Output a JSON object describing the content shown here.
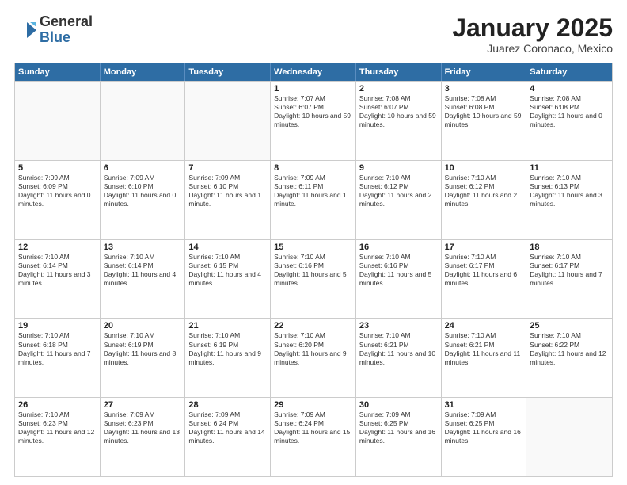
{
  "logo": {
    "general": "General",
    "blue": "Blue"
  },
  "header": {
    "month": "January 2025",
    "location": "Juarez Coronaco, Mexico"
  },
  "weekdays": [
    "Sunday",
    "Monday",
    "Tuesday",
    "Wednesday",
    "Thursday",
    "Friday",
    "Saturday"
  ],
  "weeks": [
    [
      {
        "day": "",
        "info": ""
      },
      {
        "day": "",
        "info": ""
      },
      {
        "day": "",
        "info": ""
      },
      {
        "day": "1",
        "info": "Sunrise: 7:07 AM\nSunset: 6:07 PM\nDaylight: 10 hours and 59 minutes."
      },
      {
        "day": "2",
        "info": "Sunrise: 7:08 AM\nSunset: 6:07 PM\nDaylight: 10 hours and 59 minutes."
      },
      {
        "day": "3",
        "info": "Sunrise: 7:08 AM\nSunset: 6:08 PM\nDaylight: 10 hours and 59 minutes."
      },
      {
        "day": "4",
        "info": "Sunrise: 7:08 AM\nSunset: 6:08 PM\nDaylight: 11 hours and 0 minutes."
      }
    ],
    [
      {
        "day": "5",
        "info": "Sunrise: 7:09 AM\nSunset: 6:09 PM\nDaylight: 11 hours and 0 minutes."
      },
      {
        "day": "6",
        "info": "Sunrise: 7:09 AM\nSunset: 6:10 PM\nDaylight: 11 hours and 0 minutes."
      },
      {
        "day": "7",
        "info": "Sunrise: 7:09 AM\nSunset: 6:10 PM\nDaylight: 11 hours and 1 minute."
      },
      {
        "day": "8",
        "info": "Sunrise: 7:09 AM\nSunset: 6:11 PM\nDaylight: 11 hours and 1 minute."
      },
      {
        "day": "9",
        "info": "Sunrise: 7:10 AM\nSunset: 6:12 PM\nDaylight: 11 hours and 2 minutes."
      },
      {
        "day": "10",
        "info": "Sunrise: 7:10 AM\nSunset: 6:12 PM\nDaylight: 11 hours and 2 minutes."
      },
      {
        "day": "11",
        "info": "Sunrise: 7:10 AM\nSunset: 6:13 PM\nDaylight: 11 hours and 3 minutes."
      }
    ],
    [
      {
        "day": "12",
        "info": "Sunrise: 7:10 AM\nSunset: 6:14 PM\nDaylight: 11 hours and 3 minutes."
      },
      {
        "day": "13",
        "info": "Sunrise: 7:10 AM\nSunset: 6:14 PM\nDaylight: 11 hours and 4 minutes."
      },
      {
        "day": "14",
        "info": "Sunrise: 7:10 AM\nSunset: 6:15 PM\nDaylight: 11 hours and 4 minutes."
      },
      {
        "day": "15",
        "info": "Sunrise: 7:10 AM\nSunset: 6:16 PM\nDaylight: 11 hours and 5 minutes."
      },
      {
        "day": "16",
        "info": "Sunrise: 7:10 AM\nSunset: 6:16 PM\nDaylight: 11 hours and 5 minutes."
      },
      {
        "day": "17",
        "info": "Sunrise: 7:10 AM\nSunset: 6:17 PM\nDaylight: 11 hours and 6 minutes."
      },
      {
        "day": "18",
        "info": "Sunrise: 7:10 AM\nSunset: 6:17 PM\nDaylight: 11 hours and 7 minutes."
      }
    ],
    [
      {
        "day": "19",
        "info": "Sunrise: 7:10 AM\nSunset: 6:18 PM\nDaylight: 11 hours and 7 minutes."
      },
      {
        "day": "20",
        "info": "Sunrise: 7:10 AM\nSunset: 6:19 PM\nDaylight: 11 hours and 8 minutes."
      },
      {
        "day": "21",
        "info": "Sunrise: 7:10 AM\nSunset: 6:19 PM\nDaylight: 11 hours and 9 minutes."
      },
      {
        "day": "22",
        "info": "Sunrise: 7:10 AM\nSunset: 6:20 PM\nDaylight: 11 hours and 9 minutes."
      },
      {
        "day": "23",
        "info": "Sunrise: 7:10 AM\nSunset: 6:21 PM\nDaylight: 11 hours and 10 minutes."
      },
      {
        "day": "24",
        "info": "Sunrise: 7:10 AM\nSunset: 6:21 PM\nDaylight: 11 hours and 11 minutes."
      },
      {
        "day": "25",
        "info": "Sunrise: 7:10 AM\nSunset: 6:22 PM\nDaylight: 11 hours and 12 minutes."
      }
    ],
    [
      {
        "day": "26",
        "info": "Sunrise: 7:10 AM\nSunset: 6:23 PM\nDaylight: 11 hours and 12 minutes."
      },
      {
        "day": "27",
        "info": "Sunrise: 7:09 AM\nSunset: 6:23 PM\nDaylight: 11 hours and 13 minutes."
      },
      {
        "day": "28",
        "info": "Sunrise: 7:09 AM\nSunset: 6:24 PM\nDaylight: 11 hours and 14 minutes."
      },
      {
        "day": "29",
        "info": "Sunrise: 7:09 AM\nSunset: 6:24 PM\nDaylight: 11 hours and 15 minutes."
      },
      {
        "day": "30",
        "info": "Sunrise: 7:09 AM\nSunset: 6:25 PM\nDaylight: 11 hours and 16 minutes."
      },
      {
        "day": "31",
        "info": "Sunrise: 7:09 AM\nSunset: 6:25 PM\nDaylight: 11 hours and 16 minutes."
      },
      {
        "day": "",
        "info": ""
      }
    ]
  ]
}
